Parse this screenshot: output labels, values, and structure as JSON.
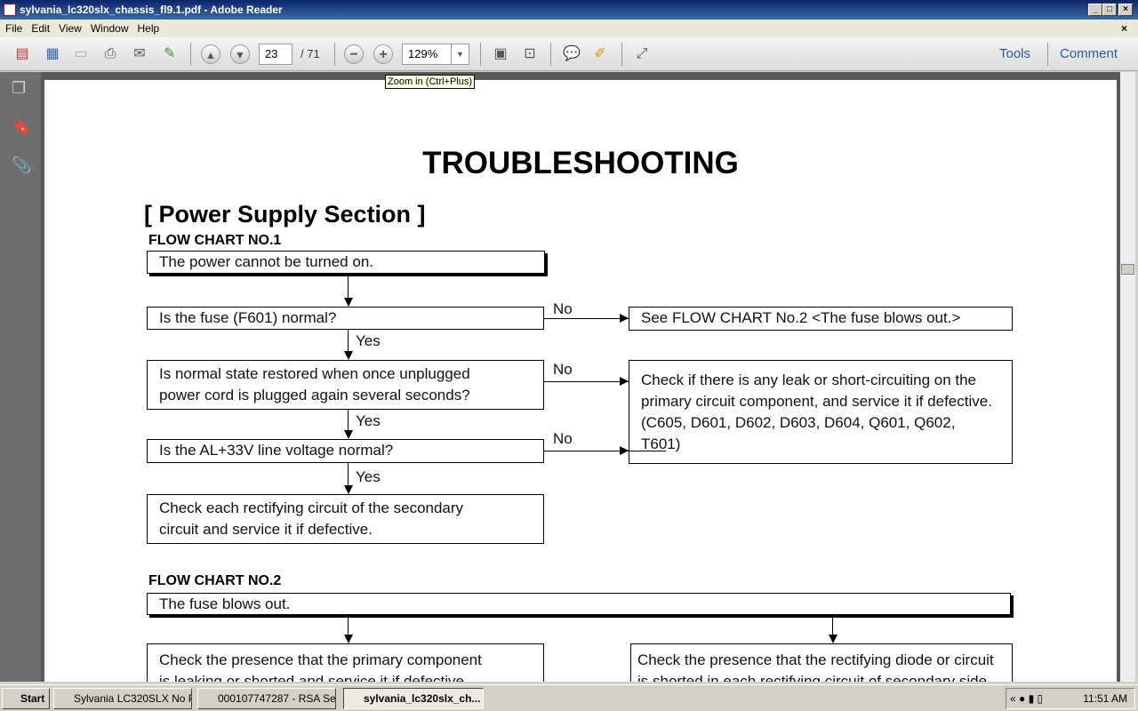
{
  "window": {
    "title": "sylvania_lc320slx_chassis_fl9.1.pdf - Adobe Reader"
  },
  "menu": [
    "File",
    "Edit",
    "View",
    "Window",
    "Help"
  ],
  "toolbar": {
    "page": "23",
    "page_count": "/ 71",
    "zoom": "129%",
    "tools": "Tools",
    "comment": "Comment",
    "tooltip": "Zoom in (Ctrl+Plus)"
  },
  "doc": {
    "title": "TROUBLESHOOTING",
    "section": "[ Power Supply Section ]",
    "fc1": {
      "heading": "FLOW CHART NO.1",
      "start": "The power cannot be turned on.",
      "q1": "Is the fuse (F601) normal?",
      "q1_no": "See FLOW CHART No.2 <The fuse blows out.>",
      "q2": [
        "Is normal state restored when once unplugged",
        "power cord is plugged again several seconds?"
      ],
      "q2_no": [
        "Check if there is any leak or short-circuiting on the",
        "primary circuit component, and service it if defective.",
        "(C605, D601, D602, D603, D604, Q601, Q602,",
        "T601)"
      ],
      "q3": "Is the AL+33V line voltage normal?",
      "end": [
        "Check each rectifying circuit of the secondary",
        "circuit and service it if defective."
      ],
      "yes": "Yes",
      "no": "No"
    },
    "fc2": {
      "heading": "FLOW CHART NO.2",
      "start": "The fuse blows out.",
      "left": [
        "Check the presence that the primary component",
        "is leaking or shorted and service it if defective."
      ],
      "right": [
        "Check the presence that the rectifying diode or circuit",
        "is shorted in each rectifying circuit of secondary side."
      ]
    }
  },
  "taskbar": {
    "start": "Start",
    "tasks": [
      "Sylvania LC320SLX No P...",
      "000107747287 - RSA Se...",
      "sylvania_lc320slx_ch..."
    ],
    "clock": "11:51 AM"
  }
}
